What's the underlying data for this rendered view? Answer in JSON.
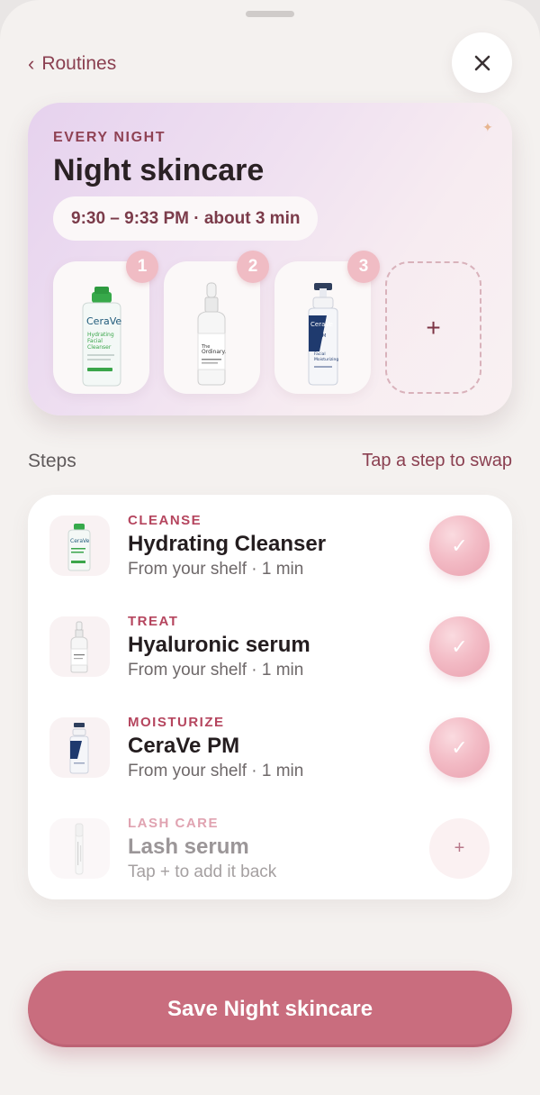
{
  "nav": {
    "back_chevron": "‹",
    "back_label": "Routines",
    "close_glyph": "✕"
  },
  "routine": {
    "frequency": "EVERY NIGHT",
    "title": "Night skincare",
    "time_range": "9:30 – 9:33 PM · about 3 min",
    "slots": [
      {
        "number": "1",
        "product_icon": "cerave-cleanser-bottle-icon"
      },
      {
        "number": "2",
        "product_icon": "ordinary-serum-dropper-icon"
      },
      {
        "number": "3",
        "product_icon": "cerave-pm-pump-icon"
      }
    ],
    "add_slot_glyph": "+"
  },
  "steps_section": {
    "label": "Steps",
    "hint": "Tap a step to swap"
  },
  "steps": [
    {
      "category": "CLEANSE",
      "name": "Hydrating Cleanser",
      "meta": "From your shelf · 1 min",
      "status": "done",
      "action_glyph": "✓",
      "icon": "cerave-cleanser-bottle-icon"
    },
    {
      "category": "TREAT",
      "name": "Hyaluronic serum",
      "meta": "From your shelf · 1 min",
      "status": "done",
      "action_glyph": "✓",
      "icon": "ordinary-serum-dropper-icon"
    },
    {
      "category": "MOISTURIZE",
      "name": "CeraVe PM",
      "meta": "From your shelf · 1 min",
      "status": "done",
      "action_glyph": "✓",
      "icon": "cerave-pm-pump-icon"
    },
    {
      "category": "LASH CARE",
      "name": "Lash serum",
      "meta": "Tap + to add it back",
      "status": "removed",
      "action_glyph": "+",
      "icon": "lash-serum-tube-icon"
    }
  ],
  "save_label": "Save Night skincare",
  "colors": {
    "accent": "#c96d7e",
    "category_text": "#b5455e",
    "badge": "#f0bcc4"
  }
}
